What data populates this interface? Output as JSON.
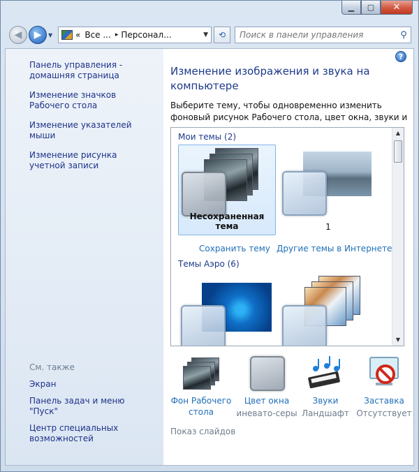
{
  "window": {
    "minimize": "▁",
    "maximize": "▢",
    "close": "✕"
  },
  "nav": {
    "back_icon": "◀",
    "forward_icon": "▶",
    "address": {
      "prefix": "«",
      "segments": [
        "Все ...",
        "Персонал..."
      ],
      "separator": "▸"
    },
    "refresh_icon": "⟲",
    "search_placeholder": "Поиск в панели управления",
    "search_icon": "⚲"
  },
  "sidebar": {
    "links": [
      "Панель управления - домашняя страница",
      "Изменение значков Рабочего стола",
      "Изменение указателей мыши",
      "Изменение рисунка учетной записи"
    ],
    "see_also_title": "См. также",
    "see_also": [
      "Экран",
      "Панель задач и меню \"Пуск\"",
      "Центр специальных возможностей"
    ]
  },
  "main": {
    "help_icon": "?",
    "title": "Изменение изображения и звука на компьютере",
    "subtitle": "Выберите тему, чтобы одновременно изменить фоновый рисунок Рабочего стола, цвет окна, звуки и заставку.",
    "my_themes_label": "Мои темы (2)",
    "my_themes": [
      {
        "name": "Несохраненная тема",
        "selected": true
      },
      {
        "name": "1",
        "selected": false
      }
    ],
    "save_theme_link": "Сохранить тему",
    "more_themes_link": "Другие темы в Интернете",
    "aero_label": "Темы Аэро (6)"
  },
  "settings": [
    {
      "label": "Фон Рабочего стола",
      "sub": "",
      "icon": "desktop-background-icon"
    },
    {
      "label": "Цвет окна",
      "sub": "иневато-серы",
      "icon": "window-color-icon"
    },
    {
      "label": "Звуки",
      "sub": "Ландшафт",
      "icon": "sounds-icon"
    },
    {
      "label": "Заставка",
      "sub": "Отсутствует",
      "icon": "screensaver-icon"
    }
  ],
  "slideshow_label": "Показ слайдов",
  "colors": {
    "link": "#1f6fb8",
    "title": "#1e3a8a",
    "close_button": "#c2381f"
  }
}
